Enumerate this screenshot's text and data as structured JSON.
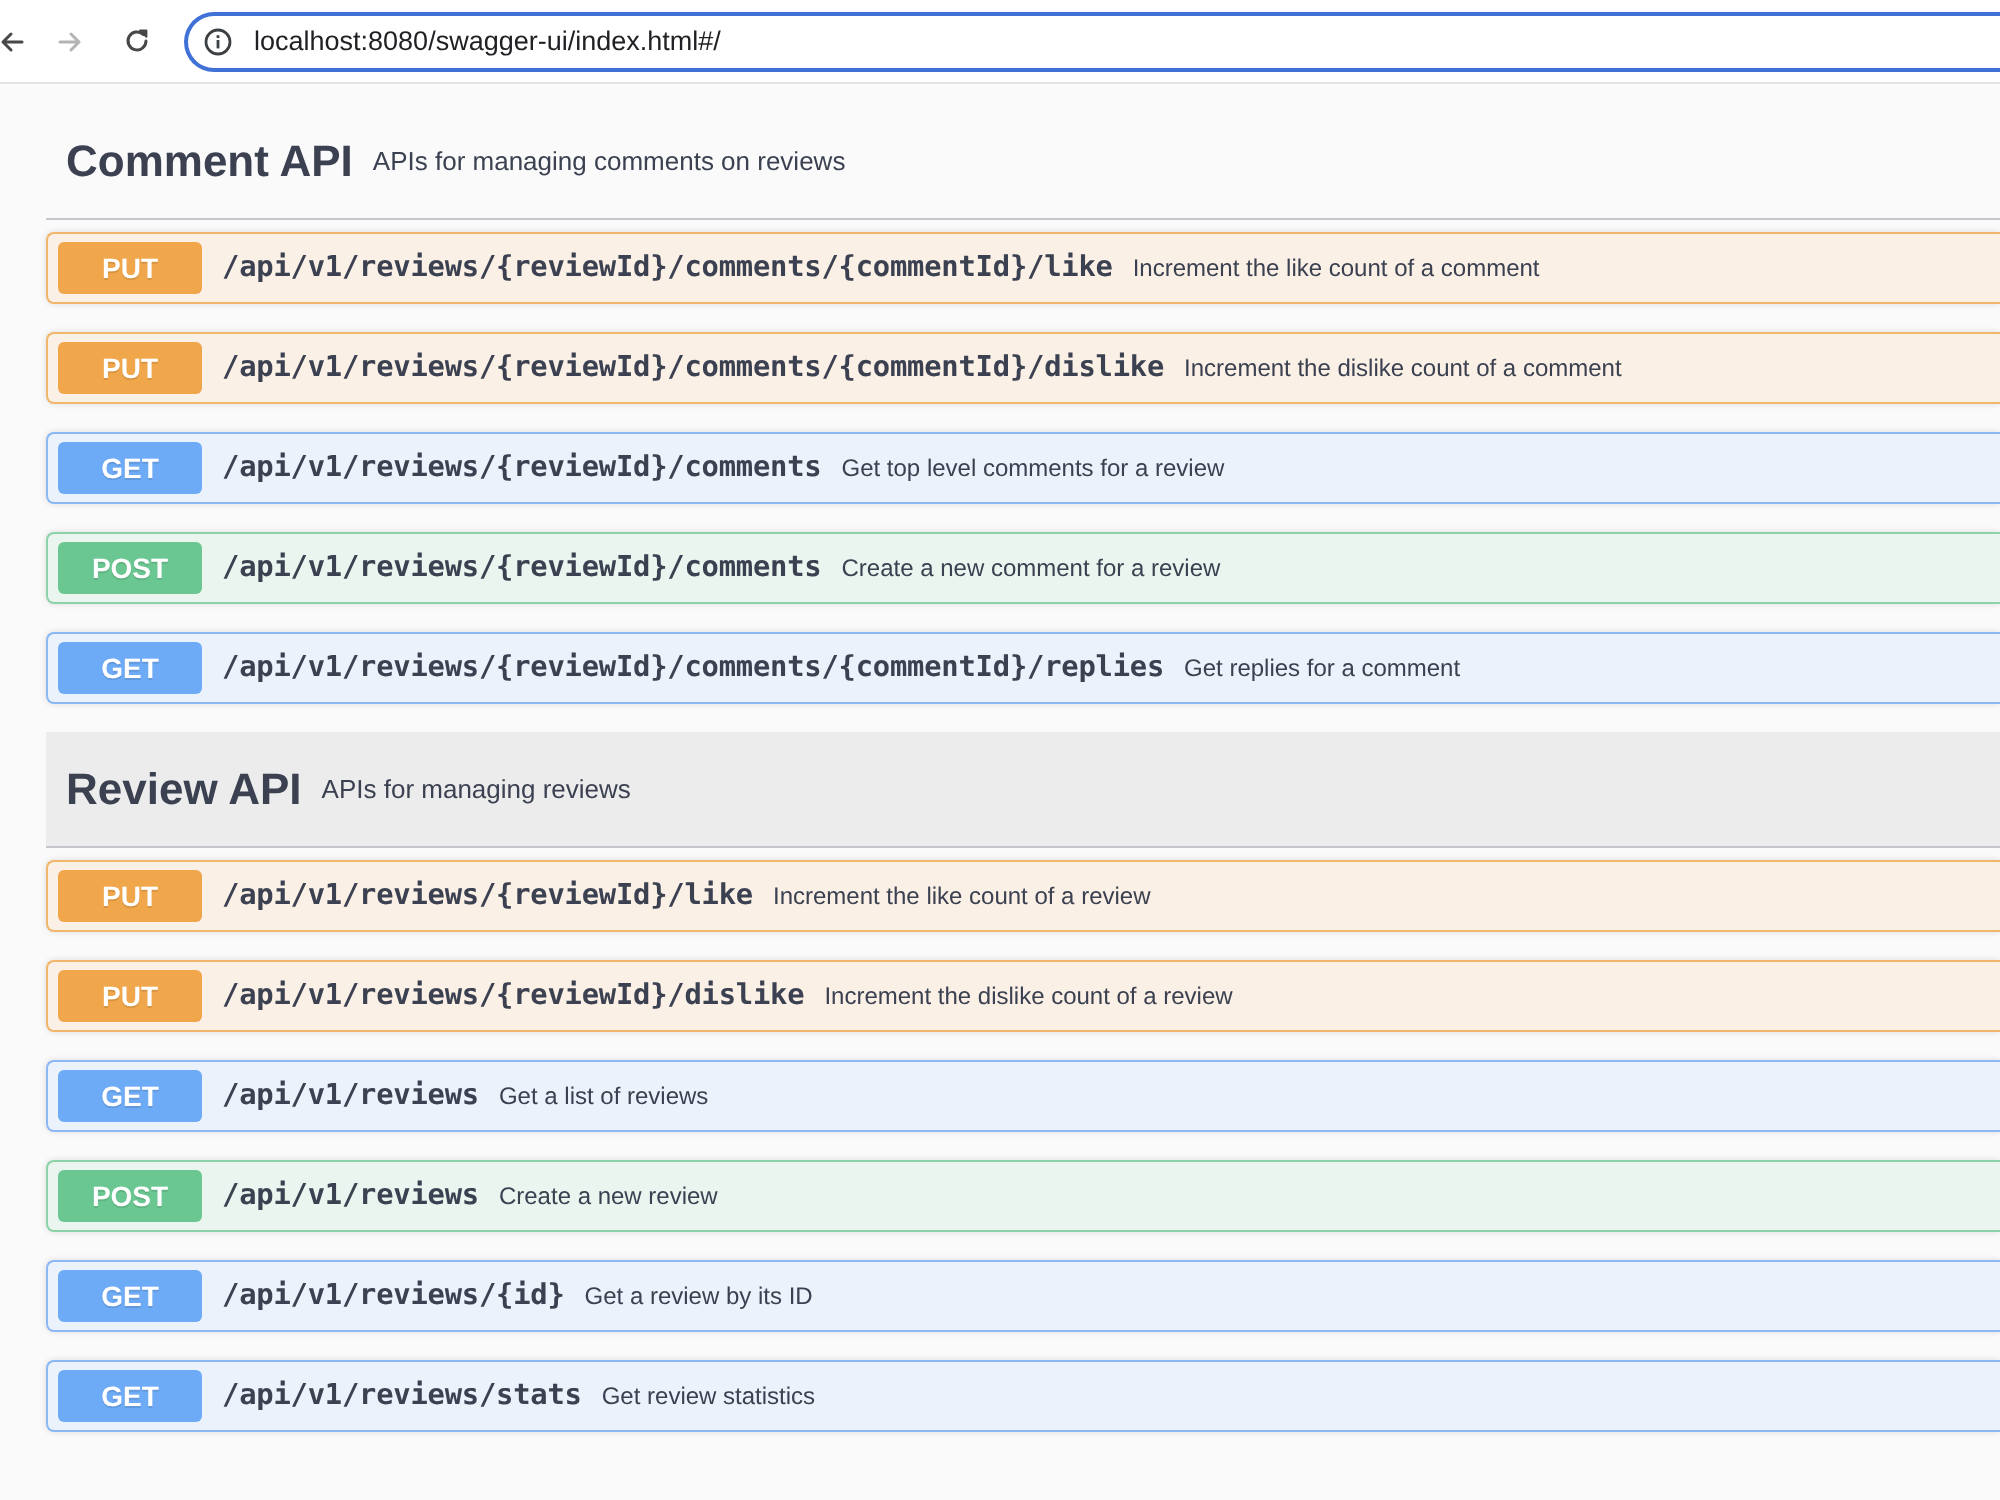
{
  "browser": {
    "nav_buttons": [
      {
        "kind": "back",
        "disabled": false
      },
      {
        "kind": "forward",
        "disabled": true
      },
      {
        "kind": "reload",
        "disabled": false
      }
    ],
    "address": {
      "value": "localhost:8080/swagger-ui/index.html#/",
      "focused": true
    }
  },
  "sections": [
    {
      "title": "Comment API",
      "description": "APIs for managing comments on reviews",
      "highlighted": false,
      "operations": [
        {
          "kind": "put",
          "method": "PUT",
          "path": "/api/v1/reviews/{reviewId}/comments/{commentId}/like",
          "summary": "Increment the like count of a comment"
        },
        {
          "kind": "put",
          "method": "PUT",
          "path": "/api/v1/reviews/{reviewId}/comments/{commentId}/dislike",
          "summary": "Increment the dislike count of a comment"
        },
        {
          "kind": "get",
          "method": "GET",
          "path": "/api/v1/reviews/{reviewId}/comments",
          "summary": "Get top level comments for a review"
        },
        {
          "kind": "post",
          "method": "POST",
          "path": "/api/v1/reviews/{reviewId}/comments",
          "summary": "Create a new comment for a review"
        },
        {
          "kind": "get",
          "method": "GET",
          "path": "/api/v1/reviews/{reviewId}/comments/{commentId}/replies",
          "summary": "Get replies for a comment"
        }
      ]
    },
    {
      "title": "Review API",
      "description": "APIs for managing reviews",
      "highlighted": true,
      "operations": [
        {
          "kind": "put",
          "method": "PUT",
          "path": "/api/v1/reviews/{reviewId}/like",
          "summary": "Increment the like count of a review"
        },
        {
          "kind": "put",
          "method": "PUT",
          "path": "/api/v1/reviews/{reviewId}/dislike",
          "summary": "Increment the dislike count of a review"
        },
        {
          "kind": "get",
          "method": "GET",
          "path": "/api/v1/reviews",
          "summary": "Get a list of reviews"
        },
        {
          "kind": "post",
          "method": "POST",
          "path": "/api/v1/reviews",
          "summary": "Create a new review"
        },
        {
          "kind": "get",
          "method": "GET",
          "path": "/api/v1/reviews/{id}",
          "summary": "Get a review by its ID"
        },
        {
          "kind": "get",
          "method": "GET",
          "path": "/api/v1/reviews/stats",
          "summary": "Get review statistics"
        }
      ]
    }
  ]
}
